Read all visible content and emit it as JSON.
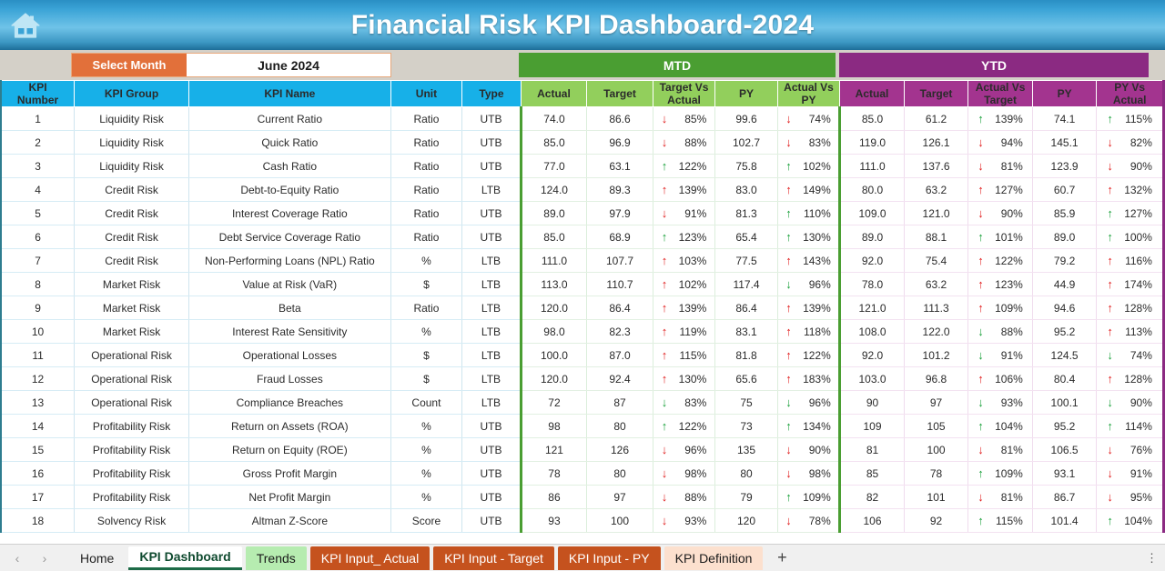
{
  "window": {
    "title": "Financial Risk KPI Dashboard-2024",
    "home_icon": "home-icon"
  },
  "controls": {
    "select_month_label": "Select Month",
    "select_month_value": "June 2024"
  },
  "bands": {
    "mtd": "MTD",
    "ytd": "YTD"
  },
  "colors": {
    "header_blue": "#17b0e8",
    "header_green": "#92cf5c",
    "header_purple": "#a3348f",
    "band_green": "#4a9e32",
    "band_purple": "#8b2a82",
    "orange": "#e2703a",
    "up_good": "#19a03a",
    "down_bad": "#e01b1b"
  },
  "table": {
    "columns_info": [
      "KPI\nNumber",
      "KPI Group",
      "KPI Name",
      "Unit",
      "Type"
    ],
    "headers": {
      "kpi_number": "KPI Number",
      "kpi_number_l1": "KPI",
      "kpi_number_l2": "Number",
      "kpi_group": "KPI Group",
      "kpi_name": "KPI Name",
      "unit": "Unit",
      "type": "Type",
      "mtd_actual": "Actual",
      "mtd_target": "Target",
      "mtd_tva_l1": "Target Vs",
      "mtd_tva_l2": "Actual",
      "mtd_py": "PY",
      "mtd_avp_l1": "Actual Vs",
      "mtd_avp_l2": "PY",
      "ytd_actual": "Actual",
      "ytd_target": "Target",
      "ytd_avt_l1": "Actual Vs",
      "ytd_avt_l2": "Target",
      "ytd_py": "PY",
      "ytd_pva_l1": "PY Vs",
      "ytd_pva_l2": "Actual"
    },
    "rows": [
      {
        "n": "1",
        "group": "Liquidity Risk",
        "name": "Current Ratio",
        "unit": "Ratio",
        "type": "UTB",
        "mtd_actual": "74.0",
        "mtd_target": "86.6",
        "mtd_tva": {
          "dir": "down",
          "color": "red",
          "pct": "85%"
        },
        "mtd_py": "99.6",
        "mtd_avp": {
          "dir": "down",
          "color": "red",
          "pct": "74%"
        },
        "ytd_actual": "85.0",
        "ytd_target": "61.2",
        "ytd_avt": {
          "dir": "up",
          "color": "green",
          "pct": "139%"
        },
        "ytd_py": "74.1",
        "ytd_pva": {
          "dir": "up",
          "color": "green",
          "pct": "115%"
        }
      },
      {
        "n": "2",
        "group": "Liquidity Risk",
        "name": "Quick Ratio",
        "unit": "Ratio",
        "type": "UTB",
        "mtd_actual": "85.0",
        "mtd_target": "96.9",
        "mtd_tva": {
          "dir": "down",
          "color": "red",
          "pct": "88%"
        },
        "mtd_py": "102.7",
        "mtd_avp": {
          "dir": "down",
          "color": "red",
          "pct": "83%"
        },
        "ytd_actual": "119.0",
        "ytd_target": "126.1",
        "ytd_avt": {
          "dir": "down",
          "color": "red",
          "pct": "94%"
        },
        "ytd_py": "145.1",
        "ytd_pva": {
          "dir": "down",
          "color": "red",
          "pct": "82%"
        }
      },
      {
        "n": "3",
        "group": "Liquidity Risk",
        "name": "Cash Ratio",
        "unit": "Ratio",
        "type": "UTB",
        "mtd_actual": "77.0",
        "mtd_target": "63.1",
        "mtd_tva": {
          "dir": "up",
          "color": "green",
          "pct": "122%"
        },
        "mtd_py": "75.8",
        "mtd_avp": {
          "dir": "up",
          "color": "green",
          "pct": "102%"
        },
        "ytd_actual": "111.0",
        "ytd_target": "137.6",
        "ytd_avt": {
          "dir": "down",
          "color": "red",
          "pct": "81%"
        },
        "ytd_py": "123.9",
        "ytd_pva": {
          "dir": "down",
          "color": "red",
          "pct": "90%"
        }
      },
      {
        "n": "4",
        "group": "Credit Risk",
        "name": "Debt-to-Equity Ratio",
        "unit": "Ratio",
        "type": "LTB",
        "mtd_actual": "124.0",
        "mtd_target": "89.3",
        "mtd_tva": {
          "dir": "up",
          "color": "red",
          "pct": "139%"
        },
        "mtd_py": "83.0",
        "mtd_avp": {
          "dir": "up",
          "color": "red",
          "pct": "149%"
        },
        "ytd_actual": "80.0",
        "ytd_target": "63.2",
        "ytd_avt": {
          "dir": "up",
          "color": "red",
          "pct": "127%"
        },
        "ytd_py": "60.7",
        "ytd_pva": {
          "dir": "up",
          "color": "red",
          "pct": "132%"
        }
      },
      {
        "n": "5",
        "group": "Credit Risk",
        "name": "Interest Coverage Ratio",
        "unit": "Ratio",
        "type": "UTB",
        "mtd_actual": "89.0",
        "mtd_target": "97.9",
        "mtd_tva": {
          "dir": "down",
          "color": "red",
          "pct": "91%"
        },
        "mtd_py": "81.3",
        "mtd_avp": {
          "dir": "up",
          "color": "green",
          "pct": "110%"
        },
        "ytd_actual": "109.0",
        "ytd_target": "121.0",
        "ytd_avt": {
          "dir": "down",
          "color": "red",
          "pct": "90%"
        },
        "ytd_py": "85.9",
        "ytd_pva": {
          "dir": "up",
          "color": "green",
          "pct": "127%"
        }
      },
      {
        "n": "6",
        "group": "Credit Risk",
        "name": "Debt Service Coverage Ratio",
        "unit": "Ratio",
        "type": "UTB",
        "mtd_actual": "85.0",
        "mtd_target": "68.9",
        "mtd_tva": {
          "dir": "up",
          "color": "green",
          "pct": "123%"
        },
        "mtd_py": "65.4",
        "mtd_avp": {
          "dir": "up",
          "color": "green",
          "pct": "130%"
        },
        "ytd_actual": "89.0",
        "ytd_target": "88.1",
        "ytd_avt": {
          "dir": "up",
          "color": "green",
          "pct": "101%"
        },
        "ytd_py": "89.0",
        "ytd_pva": {
          "dir": "up",
          "color": "green",
          "pct": "100%"
        }
      },
      {
        "n": "7",
        "group": "Credit Risk",
        "name": "Non-Performing Loans (NPL) Ratio",
        "unit": "%",
        "type": "LTB",
        "mtd_actual": "111.0",
        "mtd_target": "107.7",
        "mtd_tva": {
          "dir": "up",
          "color": "red",
          "pct": "103%"
        },
        "mtd_py": "77.5",
        "mtd_avp": {
          "dir": "up",
          "color": "red",
          "pct": "143%"
        },
        "ytd_actual": "92.0",
        "ytd_target": "75.4",
        "ytd_avt": {
          "dir": "up",
          "color": "red",
          "pct": "122%"
        },
        "ytd_py": "79.2",
        "ytd_pva": {
          "dir": "up",
          "color": "red",
          "pct": "116%"
        }
      },
      {
        "n": "8",
        "group": "Market Risk",
        "name": "Value at Risk (VaR)",
        "unit": "$",
        "type": "LTB",
        "mtd_actual": "113.0",
        "mtd_target": "110.7",
        "mtd_tva": {
          "dir": "up",
          "color": "red",
          "pct": "102%"
        },
        "mtd_py": "117.4",
        "mtd_avp": {
          "dir": "down",
          "color": "green",
          "pct": "96%"
        },
        "ytd_actual": "78.0",
        "ytd_target": "63.2",
        "ytd_avt": {
          "dir": "up",
          "color": "red",
          "pct": "123%"
        },
        "ytd_py": "44.9",
        "ytd_pva": {
          "dir": "up",
          "color": "red",
          "pct": "174%"
        }
      },
      {
        "n": "9",
        "group": "Market Risk",
        "name": "Beta",
        "unit": "Ratio",
        "type": "LTB",
        "mtd_actual": "120.0",
        "mtd_target": "86.4",
        "mtd_tva": {
          "dir": "up",
          "color": "red",
          "pct": "139%"
        },
        "mtd_py": "86.4",
        "mtd_avp": {
          "dir": "up",
          "color": "red",
          "pct": "139%"
        },
        "ytd_actual": "121.0",
        "ytd_target": "111.3",
        "ytd_avt": {
          "dir": "up",
          "color": "red",
          "pct": "109%"
        },
        "ytd_py": "94.6",
        "ytd_pva": {
          "dir": "up",
          "color": "red",
          "pct": "128%"
        }
      },
      {
        "n": "10",
        "group": "Market Risk",
        "name": "Interest Rate Sensitivity",
        "unit": "%",
        "type": "LTB",
        "mtd_actual": "98.0",
        "mtd_target": "82.3",
        "mtd_tva": {
          "dir": "up",
          "color": "red",
          "pct": "119%"
        },
        "mtd_py": "83.1",
        "mtd_avp": {
          "dir": "up",
          "color": "red",
          "pct": "118%"
        },
        "ytd_actual": "108.0",
        "ytd_target": "122.0",
        "ytd_avt": {
          "dir": "down",
          "color": "green",
          "pct": "88%"
        },
        "ytd_py": "95.2",
        "ytd_pva": {
          "dir": "up",
          "color": "red",
          "pct": "113%"
        }
      },
      {
        "n": "11",
        "group": "Operational Risk",
        "name": "Operational Losses",
        "unit": "$",
        "type": "LTB",
        "mtd_actual": "100.0",
        "mtd_target": "87.0",
        "mtd_tva": {
          "dir": "up",
          "color": "red",
          "pct": "115%"
        },
        "mtd_py": "81.8",
        "mtd_avp": {
          "dir": "up",
          "color": "red",
          "pct": "122%"
        },
        "ytd_actual": "92.0",
        "ytd_target": "101.2",
        "ytd_avt": {
          "dir": "down",
          "color": "green",
          "pct": "91%"
        },
        "ytd_py": "124.5",
        "ytd_pva": {
          "dir": "down",
          "color": "green",
          "pct": "74%"
        }
      },
      {
        "n": "12",
        "group": "Operational Risk",
        "name": "Fraud Losses",
        "unit": "$",
        "type": "LTB",
        "mtd_actual": "120.0",
        "mtd_target": "92.4",
        "mtd_tva": {
          "dir": "up",
          "color": "red",
          "pct": "130%"
        },
        "mtd_py": "65.6",
        "mtd_avp": {
          "dir": "up",
          "color": "red",
          "pct": "183%"
        },
        "ytd_actual": "103.0",
        "ytd_target": "96.8",
        "ytd_avt": {
          "dir": "up",
          "color": "red",
          "pct": "106%"
        },
        "ytd_py": "80.4",
        "ytd_pva": {
          "dir": "up",
          "color": "red",
          "pct": "128%"
        }
      },
      {
        "n": "13",
        "group": "Operational Risk",
        "name": "Compliance Breaches",
        "unit": "Count",
        "type": "LTB",
        "mtd_actual": "72",
        "mtd_target": "87",
        "mtd_tva": {
          "dir": "down",
          "color": "green",
          "pct": "83%"
        },
        "mtd_py": "75",
        "mtd_avp": {
          "dir": "down",
          "color": "green",
          "pct": "96%"
        },
        "ytd_actual": "90",
        "ytd_target": "97",
        "ytd_avt": {
          "dir": "down",
          "color": "green",
          "pct": "93%"
        },
        "ytd_py": "100.1",
        "ytd_pva": {
          "dir": "down",
          "color": "green",
          "pct": "90%"
        }
      },
      {
        "n": "14",
        "group": "Profitability Risk",
        "name": "Return on Assets (ROA)",
        "unit": "%",
        "type": "UTB",
        "mtd_actual": "98",
        "mtd_target": "80",
        "mtd_tva": {
          "dir": "up",
          "color": "green",
          "pct": "122%"
        },
        "mtd_py": "73",
        "mtd_avp": {
          "dir": "up",
          "color": "green",
          "pct": "134%"
        },
        "ytd_actual": "109",
        "ytd_target": "105",
        "ytd_avt": {
          "dir": "up",
          "color": "green",
          "pct": "104%"
        },
        "ytd_py": "95.2",
        "ytd_pva": {
          "dir": "up",
          "color": "green",
          "pct": "114%"
        }
      },
      {
        "n": "15",
        "group": "Profitability Risk",
        "name": "Return on Equity (ROE)",
        "unit": "%",
        "type": "UTB",
        "mtd_actual": "121",
        "mtd_target": "126",
        "mtd_tva": {
          "dir": "down",
          "color": "red",
          "pct": "96%"
        },
        "mtd_py": "135",
        "mtd_avp": {
          "dir": "down",
          "color": "red",
          "pct": "90%"
        },
        "ytd_actual": "81",
        "ytd_target": "100",
        "ytd_avt": {
          "dir": "down",
          "color": "red",
          "pct": "81%"
        },
        "ytd_py": "106.5",
        "ytd_pva": {
          "dir": "down",
          "color": "red",
          "pct": "76%"
        }
      },
      {
        "n": "16",
        "group": "Profitability Risk",
        "name": "Gross Profit Margin",
        "unit": "%",
        "type": "UTB",
        "mtd_actual": "78",
        "mtd_target": "80",
        "mtd_tva": {
          "dir": "down",
          "color": "red",
          "pct": "98%"
        },
        "mtd_py": "80",
        "mtd_avp": {
          "dir": "down",
          "color": "red",
          "pct": "98%"
        },
        "ytd_actual": "85",
        "ytd_target": "78",
        "ytd_avt": {
          "dir": "up",
          "color": "green",
          "pct": "109%"
        },
        "ytd_py": "93.1",
        "ytd_pva": {
          "dir": "down",
          "color": "red",
          "pct": "91%"
        }
      },
      {
        "n": "17",
        "group": "Profitability Risk",
        "name": "Net Profit Margin",
        "unit": "%",
        "type": "UTB",
        "mtd_actual": "86",
        "mtd_target": "97",
        "mtd_tva": {
          "dir": "down",
          "color": "red",
          "pct": "88%"
        },
        "mtd_py": "79",
        "mtd_avp": {
          "dir": "up",
          "color": "green",
          "pct": "109%"
        },
        "ytd_actual": "82",
        "ytd_target": "101",
        "ytd_avt": {
          "dir": "down",
          "color": "red",
          "pct": "81%"
        },
        "ytd_py": "86.7",
        "ytd_pva": {
          "dir": "down",
          "color": "red",
          "pct": "95%"
        }
      },
      {
        "n": "18",
        "group": "Solvency Risk",
        "name": "Altman Z-Score",
        "unit": "Score",
        "type": "UTB",
        "mtd_actual": "93",
        "mtd_target": "100",
        "mtd_tva": {
          "dir": "down",
          "color": "red",
          "pct": "93%"
        },
        "mtd_py": "120",
        "mtd_avp": {
          "dir": "down",
          "color": "red",
          "pct": "78%"
        },
        "ytd_actual": "106",
        "ytd_target": "92",
        "ytd_avt": {
          "dir": "up",
          "color": "green",
          "pct": "115%"
        },
        "ytd_py": "101.4",
        "ytd_pva": {
          "dir": "up",
          "color": "green",
          "pct": "104%"
        }
      }
    ]
  },
  "sheet_tabs": {
    "prev_label": "‹",
    "next_label": "›",
    "add_label": "+",
    "kebab_label": "⋮",
    "items": [
      {
        "label": "Home",
        "style": "plain"
      },
      {
        "label": "KPI Dashboard",
        "style": "active"
      },
      {
        "label": "Trends",
        "style": "green"
      },
      {
        "label": "KPI Input_ Actual",
        "style": "orange"
      },
      {
        "label": "KPI Input - Target",
        "style": "orange"
      },
      {
        "label": "KPI Input - PY",
        "style": "orange"
      },
      {
        "label": "KPI Definition",
        "style": "lightorange"
      }
    ]
  }
}
